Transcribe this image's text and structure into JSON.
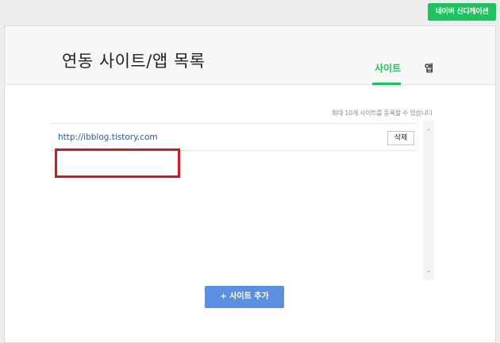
{
  "top_button": {
    "label": "네이버 신디케이션"
  },
  "header": {
    "title": "연동 사이트/앱 목록",
    "tabs": [
      {
        "label": "사이트",
        "active": true
      },
      {
        "label": "앱",
        "active": false
      }
    ]
  },
  "notice": "최대 10개 사이트를 등록할 수 있습니다",
  "sites": [
    {
      "url": "http://ibblog.tistory.com",
      "delete_label": "삭제"
    }
  ],
  "add_button": {
    "label": "+ 사이트 추가"
  },
  "colors": {
    "accent_green": "#1dc35f",
    "add_button_blue": "#5b8fe2",
    "highlight_red": "#e0151b",
    "link_blue": "#2a5cb8"
  },
  "icons": {
    "scroll_up": "chevron-up-icon",
    "scroll_down": "chevron-down-icon"
  }
}
